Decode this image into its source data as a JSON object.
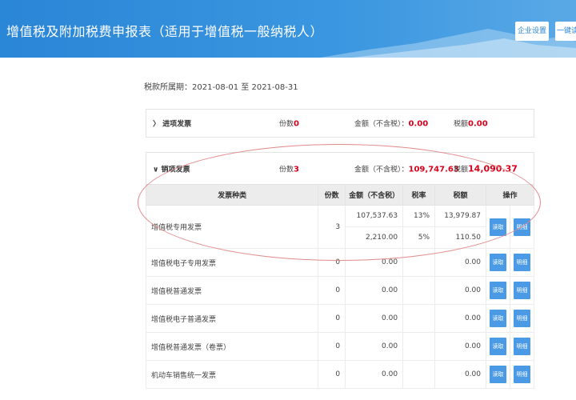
{
  "header": {
    "title": "增值税及附加税费申报表（适用于增值税一般纳税人）",
    "settings_button": "企业设置",
    "onekey_button": "一键读取"
  },
  "period": "税款所属期：2021-08-01 至 2021-08-31",
  "purchase": {
    "label": "进项发票",
    "expand_icon": "chevron-right-icon",
    "count_label": "份数",
    "count": "0",
    "amount_label": "金额（不含税）：",
    "amount": "0.00",
    "tax_label": "税额",
    "tax": "0.00"
  },
  "sales": {
    "label": "销项发票",
    "expand_icon": "chevron-down-icon",
    "count_label": "份数",
    "count": "3",
    "amount_label": "金额（不含税）：",
    "amount": "109,747.63",
    "tax_label": "税额",
    "tax": "14,090.37"
  },
  "table": {
    "headers": [
      "发票种类",
      "份数",
      "金额（不含税）",
      "税率",
      "税额",
      "操作"
    ],
    "read_label": "读取",
    "detail_label": "明细",
    "rows": [
      {
        "name": "增值税专用发票",
        "count": "3",
        "sub": [
          {
            "amount": "107,537.63",
            "rate": "13%",
            "tax": "13,979.87"
          },
          {
            "amount": "2,210.00",
            "rate": "5%",
            "tax": "110.50"
          }
        ]
      },
      {
        "name": "增值税电子专用发票",
        "count": "0",
        "amount": "0.00",
        "rate": "",
        "tax": "0.00"
      },
      {
        "name": "增值税普通发票",
        "count": "0",
        "amount": "0.00",
        "rate": "",
        "tax": "0.00"
      },
      {
        "name": "增值税电子普通发票",
        "count": "0",
        "amount": "0.00",
        "rate": "",
        "tax": "0.00"
      },
      {
        "name": "增值税普通发票（卷票）",
        "count": "0",
        "amount": "0.00",
        "rate": "",
        "tax": "0.00"
      },
      {
        "name": "机动车销售统一发票",
        "count": "0",
        "amount": "0.00",
        "rate": "",
        "tax": "0.00"
      }
    ]
  },
  "colors": {
    "header_bg": "#2a86d6",
    "accent_red": "#d9001b",
    "button_blue": "#4a9ae6",
    "annotation_ellipse": "#e28a8a"
  }
}
